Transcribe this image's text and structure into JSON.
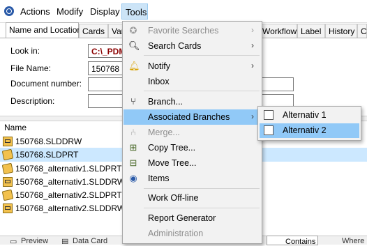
{
  "menubar": {
    "items": [
      {
        "label": "Actions"
      },
      {
        "label": "Modify"
      },
      {
        "label": "Display"
      },
      {
        "label": "Tools"
      }
    ]
  },
  "tabs": [
    {
      "label": "Name and Location"
    },
    {
      "label": "Cards"
    },
    {
      "label": "Var"
    },
    {
      "label": "Workflow"
    },
    {
      "label": "Label"
    },
    {
      "label": "History"
    },
    {
      "label": "Co"
    }
  ],
  "form": {
    "look_in_label": "Look in:",
    "look_in_value": "C:\\_PDM",
    "file_name_label": "File Name:",
    "file_name_value": "150768",
    "document_number_label": "Document number:",
    "description_label": "Description:"
  },
  "list": {
    "header": "Name",
    "rows": [
      {
        "name": "150768.SLDDRW",
        "icon": "drawing-file-icon"
      },
      {
        "name": "150768.SLDPRT",
        "icon": "part-file-icon"
      },
      {
        "name": "150768_alternativ1.SLDPRT",
        "icon": "part-file-icon"
      },
      {
        "name": "150768_alternativ1.SLDDRW",
        "icon": "drawing-file-icon"
      },
      {
        "name": "150768_alternativ2.SLDPRT",
        "icon": "part-file-icon"
      },
      {
        "name": "150768_alternativ2.SLDDRW",
        "icon": "drawing-file-icon"
      }
    ]
  },
  "tools_menu": {
    "items": [
      {
        "label": "Favorite Searches",
        "enabled": false,
        "submenu": true,
        "icon": "favorites-icon"
      },
      {
        "label": "Search Cards",
        "enabled": true,
        "submenu": true,
        "icon": "search-icon"
      },
      {
        "label": "Notify",
        "enabled": true,
        "submenu": true,
        "icon": "bell-icon"
      },
      {
        "label": "Inbox",
        "enabled": true,
        "submenu": false,
        "icon": "inbox-icon"
      },
      {
        "label": "Branch...",
        "enabled": true,
        "submenu": false,
        "icon": "branch-icon"
      },
      {
        "label": "Associated Branches",
        "enabled": true,
        "submenu": true,
        "highlighted": true,
        "icon": "associated-branches-icon"
      },
      {
        "label": "Merge...",
        "enabled": false,
        "submenu": false,
        "icon": "merge-icon"
      },
      {
        "label": "Copy Tree...",
        "enabled": true,
        "submenu": false,
        "icon": "copy-tree-icon"
      },
      {
        "label": "Move Tree...",
        "enabled": true,
        "submenu": false,
        "icon": "move-tree-icon"
      },
      {
        "label": "Items",
        "enabled": true,
        "submenu": false,
        "icon": "items-icon"
      },
      {
        "label": "Work Off-line",
        "enabled": true,
        "submenu": false,
        "icon": ""
      },
      {
        "label": "Report Generator",
        "enabled": true,
        "submenu": false,
        "icon": ""
      },
      {
        "label": "Administration",
        "enabled": false,
        "submenu": false,
        "icon": ""
      }
    ]
  },
  "submenu": {
    "items": [
      {
        "label": "Alternativ 1",
        "highlighted": false
      },
      {
        "label": "Alternativ 2",
        "highlighted": true
      }
    ]
  },
  "bottom_bar": {
    "preview": "Preview",
    "data_card": "Data Card",
    "contains": "Contains",
    "where": "Where"
  },
  "colors": {
    "highlight": "#91c9f7",
    "selected_row": "#cce8ff",
    "look_in_text": "#8b0000",
    "disabled_text": "#8d8d8d"
  }
}
